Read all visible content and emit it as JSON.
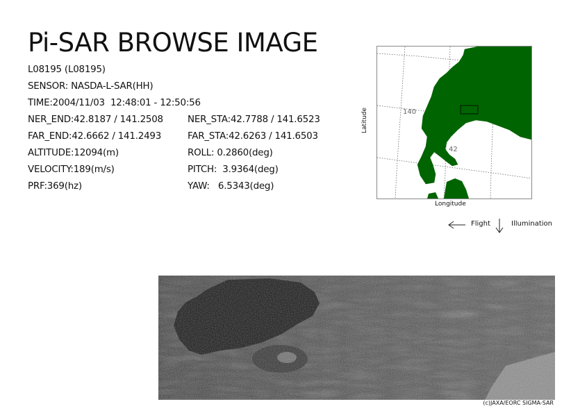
{
  "header": {
    "title": "Pi-SAR BROWSE IMAGE"
  },
  "info": {
    "scene_id": "L08195 (L08195)",
    "sensor": "SENSOR: NASDA-L-SAR(HH)",
    "time": "TIME:2004/11/03  12:48:01 - 12:50:56",
    "ner_end": "NER_END:42.8187 / 141.2508",
    "ner_sta": "NER_STA:42.7788 / 141.6523",
    "far_end": "FAR_END:42.6662 / 141.2493",
    "far_sta": "FAR_STA:42.6263 / 141.6503",
    "altitude": "ALTITUDE:12094(m)",
    "roll": "ROLL: 0.2860(deg)",
    "velocity": "VELOCITY:189(m/s)",
    "pitch": "PITCH:  3.9364(deg)",
    "prf": "PRF:369(hz)",
    "yaw": "YAW:   6.5343(deg)"
  },
  "map": {
    "lat_label": "Latitude",
    "lon_label": "Longitude",
    "grid_label_lon": "140",
    "grid_label_lat": "42",
    "land_color": "#006400"
  },
  "legend": {
    "flight_label": "Flight",
    "illumination_label": "Illumination",
    "flight_icon": "arrow-left-icon",
    "illumination_icon": "arrow-down-icon"
  },
  "footer": {
    "credit": "(c)JAXA/EORC SIGMA-SAR"
  }
}
